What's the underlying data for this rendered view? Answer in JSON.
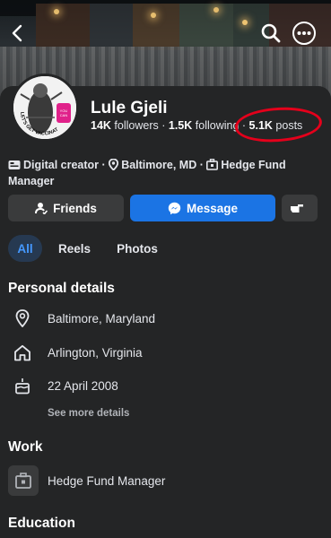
{
  "profile": {
    "name": "Lule Gjeli",
    "followers_count": "14K",
    "followers_label": "followers",
    "following_count": "1.5K",
    "following_label": "following",
    "posts_count": "5.1K",
    "posts_label": "posts",
    "avatar_text": "LET'S GET VACCINATED"
  },
  "bio": {
    "role": "Digital creator",
    "location": "Baltimore, MD",
    "job": "Hedge Fund Manager"
  },
  "actions": {
    "friends_label": "Friends",
    "message_label": "Message"
  },
  "tabs": [
    {
      "label": "All",
      "active": true
    },
    {
      "label": "Reels",
      "active": false
    },
    {
      "label": "Photos",
      "active": false
    }
  ],
  "personal_details": {
    "heading": "Personal details",
    "items": [
      {
        "icon": "location-pin-icon",
        "text": "Baltimore, Maryland"
      },
      {
        "icon": "home-icon",
        "text": "Arlington, Virginia"
      },
      {
        "icon": "birthday-cake-icon",
        "text": "22 April 2008"
      }
    ],
    "see_more": "See more details"
  },
  "work": {
    "heading": "Work",
    "title": "Hedge Fund Manager"
  },
  "education": {
    "heading": "Education"
  },
  "colors": {
    "background": "#242526",
    "primary_button": "#1b74e4",
    "secondary_button": "#3a3b3c",
    "active_tab_text": "#4599ff",
    "annotation_circle": "#e4001b"
  }
}
